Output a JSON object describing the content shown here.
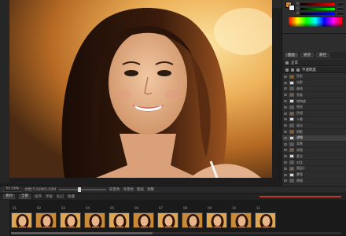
{
  "status_bar": {
    "zoom": "33.33%",
    "doc_info": "文档:5.93M/5.93M",
    "items": [
      "前景色",
      "背景色",
      "图层",
      "调整"
    ]
  },
  "film_header": {
    "folder": "素材",
    "filter": "全部",
    "labels": [
      "排序",
      "评级",
      "标记",
      "收藏"
    ],
    "accent": "#c0392b"
  },
  "panel": {
    "fg_color": "#d88a2a",
    "bg_color": "#eeeeee",
    "rgb_labels": [
      "R",
      "G",
      "B"
    ],
    "tabs": [
      "图层",
      "通道",
      "路径"
    ],
    "tool_row_1": "正常",
    "tool_row_2": "不透明度"
  },
  "layers": [
    {
      "name": "色彩",
      "selected": false
    },
    {
      "name": "光影",
      "selected": false
    },
    {
      "name": "曲线",
      "selected": false
    },
    {
      "name": "亮度",
      "selected": false
    },
    {
      "name": "饱和度",
      "selected": false
    },
    {
      "name": "锐化",
      "selected": false
    },
    {
      "name": "色相",
      "selected": false
    },
    {
      "name": "人像",
      "selected": false
    },
    {
      "name": "高光",
      "selected": false
    },
    {
      "name": "阴影",
      "selected": false
    },
    {
      "name": "滤镜",
      "selected": true
    },
    {
      "name": "背景",
      "selected": false
    },
    {
      "name": "纹理",
      "selected": false
    },
    {
      "name": "柔光",
      "selected": false
    },
    {
      "name": "对比",
      "selected": false
    },
    {
      "name": "图层1",
      "selected": false
    },
    {
      "name": "蒙版",
      "selected": false
    },
    {
      "name": "原图",
      "selected": false
    }
  ],
  "filmstrip": {
    "count": 11,
    "labels": [
      "01",
      "02",
      "03",
      "04",
      "05",
      "06",
      "07",
      "08",
      "09",
      "10",
      "11"
    ]
  },
  "colors": {
    "sunset_bright": "#f6c46a",
    "sunset_mid": "#d98a2c",
    "hair": "#2a140a",
    "skin": "#e8b48a"
  }
}
